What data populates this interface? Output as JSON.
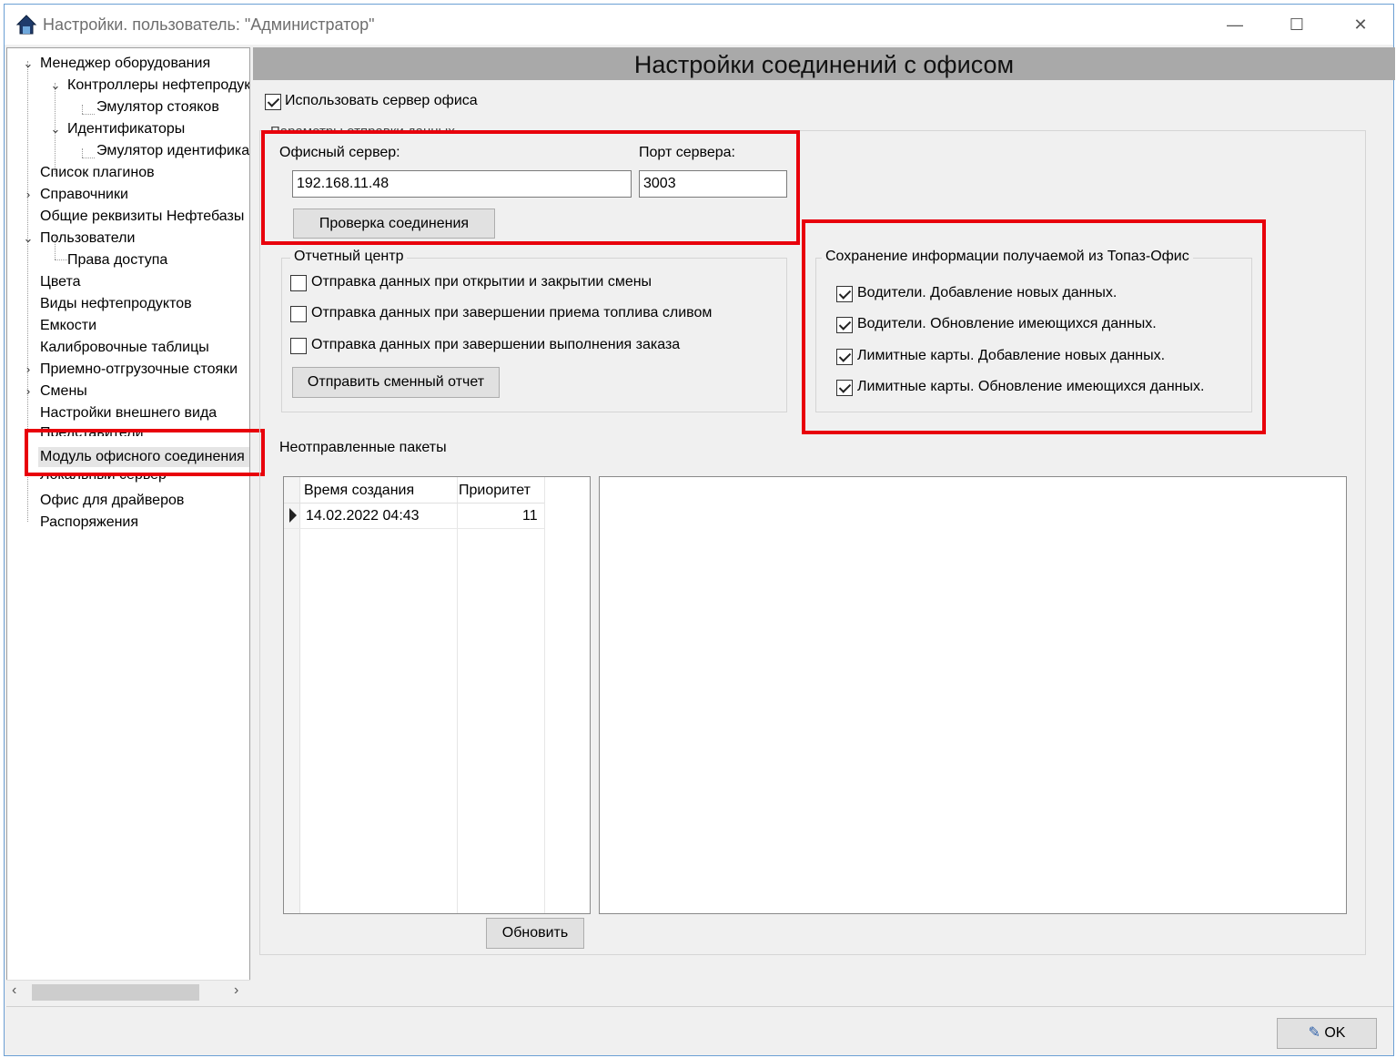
{
  "window": {
    "title": "Настройки. пользователь: \"Администратор\"",
    "minimize": "—",
    "maximize": "☐",
    "close": "✕"
  },
  "tree": {
    "items": [
      {
        "label": "Менеджер оборудования"
      },
      {
        "label": "Контроллеры нефтепродуктов"
      },
      {
        "label": "Эмулятор стояков"
      },
      {
        "label": "Идентификаторы"
      },
      {
        "label": "Эмулятор идентификаторов"
      },
      {
        "label": "Список плагинов"
      },
      {
        "label": "Справочники"
      },
      {
        "label": "Общие реквизиты Нефтебазы"
      },
      {
        "label": "Пользователи"
      },
      {
        "label": "Права доступа"
      },
      {
        "label": "Цвета"
      },
      {
        "label": "Виды нефтепродуктов"
      },
      {
        "label": "Емкости"
      },
      {
        "label": "Калибровочные таблицы"
      },
      {
        "label": "Приемно-отгрузочные стояки"
      },
      {
        "label": "Смены"
      },
      {
        "label": "Настройки внешнего вида"
      },
      {
        "label": "Представители"
      },
      {
        "label": "Модуль офисного соединения"
      },
      {
        "label": "Локальный сервер"
      },
      {
        "label": "Офис для драйверов"
      },
      {
        "label": "Распоряжения"
      }
    ]
  },
  "main": {
    "header": "Настройки соединений с офисом",
    "use_office_server": {
      "label": "Использовать сервер офиса",
      "checked": true
    },
    "send_params_group": "Параметры отправки данных",
    "office_server_label": "Офисный сервер:",
    "office_server_value": "192.168.11.48",
    "server_port_label": "Порт сервера:",
    "server_port_value": "3003",
    "check_connection_button": "Проверка соединения",
    "report_center": {
      "title": "Отчетный центр",
      "options": [
        {
          "label": "Отправка данных при открытии и закрытии смены",
          "checked": false
        },
        {
          "label": "Отправка данных при завершении приема топлива сливом",
          "checked": false
        },
        {
          "label": "Отправка данных при завершении выполнения заказа",
          "checked": false
        }
      ],
      "send_report_button": "Отправить сменный отчет"
    },
    "save_info": {
      "title": "Сохранение информации получаемой из Топаз-Офис",
      "options": [
        {
          "label": "Водители. Добавление новых данных.",
          "checked": true
        },
        {
          "label": "Водители. Обновление имеющихся данных.",
          "checked": true
        },
        {
          "label": "Лимитные карты. Добавление новых данных.",
          "checked": true
        },
        {
          "label": "Лимитные карты. Обновление имеющихся данных.",
          "checked": true
        }
      ]
    },
    "unsent_packets": {
      "title": "Неотправленные пакеты",
      "columns": [
        "Время создания",
        "Приоритет"
      ],
      "rows": [
        {
          "created": "14.02.2022 04:43",
          "priority": "11"
        }
      ],
      "refresh_button": "Обновить"
    }
  },
  "footer": {
    "ok_button": "OK"
  },
  "colors": {
    "highlight": "#e8000b",
    "header_band": "#a9a9a9",
    "window_bg": "#f0f0f0"
  }
}
